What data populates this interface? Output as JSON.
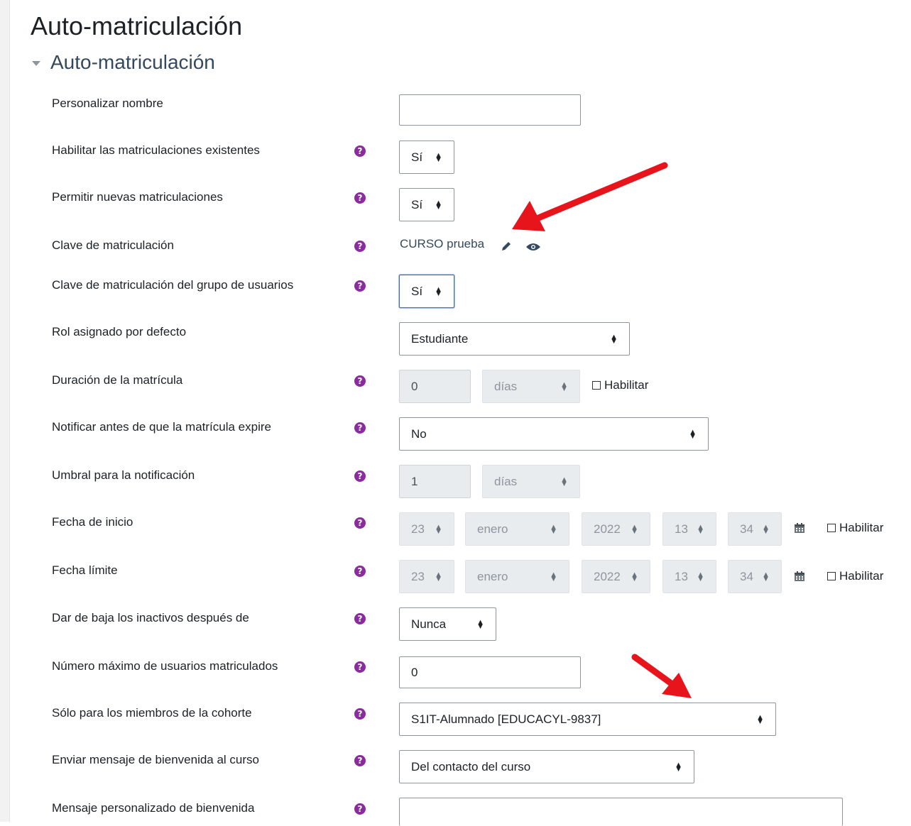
{
  "page_title": "Auto-matriculación",
  "section_title": "Auto-matriculación",
  "fields": {
    "custom_name": {
      "label": "Personalizar nombre",
      "value": ""
    },
    "enable_existing": {
      "label": "Habilitar las matriculaciones existentes",
      "value": "Sí"
    },
    "allow_new": {
      "label": "Permitir nuevas matriculaciones",
      "value": "Sí"
    },
    "enrol_key": {
      "label": "Clave de matriculación",
      "value": "CURSO prueba"
    },
    "group_key": {
      "label": "Clave de matriculación del grupo de usuarios",
      "value": "Sí"
    },
    "default_role": {
      "label": "Rol asignado por defecto",
      "value": "Estudiante"
    },
    "duration": {
      "label": "Duración de la matrícula",
      "value": "0",
      "unit": "días",
      "enable_label": "Habilitar"
    },
    "notify": {
      "label": "Notificar antes de que la matrícula expire",
      "value": "No"
    },
    "threshold": {
      "label": "Umbral para la notificación",
      "value": "1",
      "unit": "días"
    },
    "start_date": {
      "label": "Fecha de inicio",
      "day": "23",
      "month": "enero",
      "year": "2022",
      "hour": "13",
      "minute": "34",
      "enable_label": "Habilitar"
    },
    "end_date": {
      "label": "Fecha límite",
      "day": "23",
      "month": "enero",
      "year": "2022",
      "hour": "13",
      "minute": "34",
      "enable_label": "Habilitar"
    },
    "unenrol_inactive": {
      "label": "Dar de baja los inactivos después de",
      "value": "Nunca"
    },
    "max_enrolled": {
      "label": "Número máximo de usuarios matriculados",
      "value": "0"
    },
    "cohort": {
      "label": "Sólo para los miembros de la cohorte",
      "value": "S1IT-Alumnado [EDUCACYL-9837]"
    },
    "welcome": {
      "label": "Enviar mensaje de bienvenida al curso",
      "value": "Del contacto del curso"
    },
    "custom_welcome": {
      "label": "Mensaje personalizado de bienvenida",
      "value": ""
    }
  },
  "help_icon_glyph": "?",
  "colors": {
    "accent": "#8a2c9e",
    "annotation_arrow": "#e8141b",
    "link": "#34495e"
  }
}
